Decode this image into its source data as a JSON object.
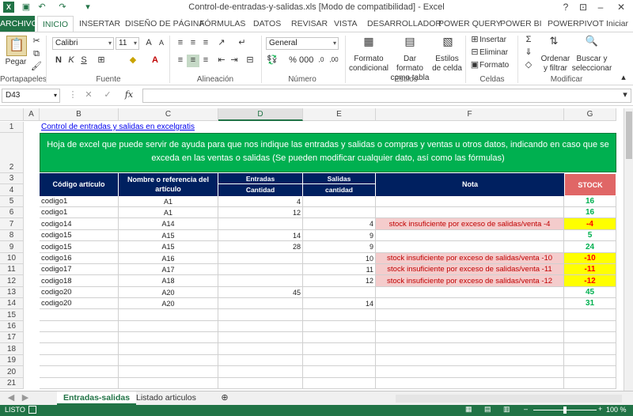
{
  "window": {
    "title": "Control-de-entradas-y-salidas.xls  [Modo de compatibilidad] - Excel",
    "help": "?",
    "user": "Iniciar"
  },
  "ribbon_tabs": [
    "ARCHIVO",
    "INICIO",
    "INSERTAR",
    "DISEÑO DE PÁGINA",
    "FÓRMULAS",
    "DATOS",
    "REVISAR",
    "VISTA",
    "DESARROLLADOR",
    "POWER QUERY",
    "POWER BI",
    "POWERPIVOT"
  ],
  "ribbon": {
    "paste": "Pegar",
    "font_name": "Calibri",
    "font_size": "11",
    "number_format": "General",
    "cond_format": "Formato condicional",
    "format_table": "Dar formato como tabla",
    "cell_styles": "Estilos de celda",
    "insert": "Insertar",
    "delete": "Eliminar",
    "format": "Formato",
    "sort_filter": "Ordenar y filtrar",
    "find_select": "Buscar y seleccionar",
    "groups": [
      "Portapapeles",
      "Fuente",
      "Alineación",
      "Número",
      "Estilos",
      "Celdas",
      "Modificar"
    ]
  },
  "formula_bar": {
    "name_box": "D43",
    "fx": "fx",
    "value": ""
  },
  "columns": [
    "A",
    "B",
    "C",
    "D",
    "E",
    "F",
    "G"
  ],
  "rows": [
    "1",
    "2",
    "3",
    "4",
    "5",
    "6",
    "7",
    "8",
    "9",
    "10",
    "11",
    "12",
    "13",
    "14",
    "15",
    "16",
    "17",
    "18",
    "19",
    "20",
    "21"
  ],
  "sheet": {
    "link": "Control de entradas y salidas en excelgratis",
    "banner": "Hoja de excel que puede servir de ayuda para que nos indique las entradas y salidas o compras y ventas u otros datos, indicando en caso que se exceda en las ventas o salidas (Se pueden modificar cualquier dato, así como las fórmulas)",
    "headers": {
      "codigo": "Código artículo",
      "nombre": "Nombre o referencia del artículo",
      "entradas": "Entradas",
      "entradas_sub": "Cantidad",
      "salidas": "Salidas",
      "salidas_sub": "cantidad",
      "nota": "Nota",
      "stock": "STOCK"
    },
    "data": [
      {
        "codigo": "codigo1",
        "ref": "A1",
        "entradas": "4",
        "salidas": "",
        "nota": "",
        "stock": "16",
        "neg": false
      },
      {
        "codigo": "codigo1",
        "ref": "A1",
        "entradas": "12",
        "salidas": "",
        "nota": "",
        "stock": "16",
        "neg": false
      },
      {
        "codigo": "codigo14",
        "ref": "A14",
        "entradas": "",
        "salidas": "4",
        "nota": "stock insuficiente por exceso de salidas/venta -4",
        "stock": "-4",
        "neg": true
      },
      {
        "codigo": "codigo15",
        "ref": "A15",
        "entradas": "14",
        "salidas": "9",
        "nota": "",
        "stock": "5",
        "neg": false
      },
      {
        "codigo": "codigo15",
        "ref": "A15",
        "entradas": "28",
        "salidas": "9",
        "nota": "",
        "stock": "24",
        "neg": false
      },
      {
        "codigo": "codigo16",
        "ref": "A16",
        "entradas": "",
        "salidas": "10",
        "nota": "stock insuficiente por exceso de salidas/venta -10",
        "stock": "-10",
        "neg": true
      },
      {
        "codigo": "codigo17",
        "ref": "A17",
        "entradas": "",
        "salidas": "11",
        "nota": "stock insuficiente por exceso de salidas/venta -11",
        "stock": "-11",
        "neg": true
      },
      {
        "codigo": "codigo18",
        "ref": "A18",
        "entradas": "",
        "salidas": "12",
        "nota": "stock insuficiente por exceso de salidas/venta -12",
        "stock": "-12",
        "neg": true
      },
      {
        "codigo": "codigo20",
        "ref": "A20",
        "entradas": "45",
        "salidas": "",
        "nota": "",
        "stock": "45",
        "neg": false
      },
      {
        "codigo": "codigo20",
        "ref": "A20",
        "entradas": "",
        "salidas": "14",
        "nota": "",
        "stock": "31",
        "neg": false
      }
    ]
  },
  "sheet_tabs": [
    "Entradas-salidas",
    "Listado articulos"
  ],
  "status": {
    "mode": "LISTO",
    "zoom": "100 %"
  },
  "colors": {
    "excel_green": "#217346",
    "header_navy": "#002060",
    "banner_green": "#00b050",
    "stock_red": "#e06666",
    "note_pink": "#f4cccc",
    "neg_yellow": "#ffff00",
    "pos_text": "#00b050",
    "neg_text": "#ff0000"
  }
}
